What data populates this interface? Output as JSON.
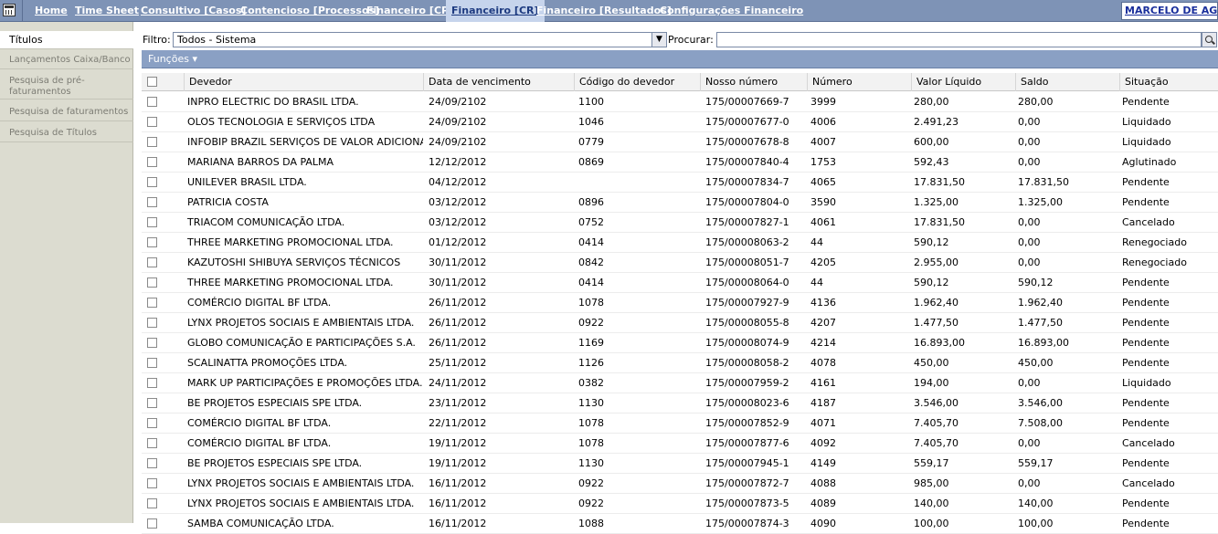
{
  "nav": {
    "links": [
      "Home",
      "Time Sheet",
      "Consultivo [Casos]",
      "Contencioso [Processos]",
      "Financeiro [CP]",
      "Financeiro [CR]",
      "Financeiro [Resultados]",
      "Configurações Financeiro"
    ],
    "active_index": 5,
    "user": "MARCELO DE AGUIAR"
  },
  "sidebar": {
    "items": [
      "Títulos",
      "Lançamentos Caixa/Banco",
      "Pesquisa de pré-faturamentos",
      "Pesquisa de faturamentos",
      "Pesquisa de Títulos"
    ],
    "active_index": 0
  },
  "filter": {
    "label": "Filtro:",
    "value": "Todos - Sistema",
    "search_label": "Procurar:",
    "search_value": ""
  },
  "functions_label": "Funções ▾",
  "table": {
    "columns": [
      "Devedor",
      "Data de vencimento",
      "Código do devedor",
      "Nosso número",
      "Número",
      "Valor Líquido",
      "Saldo",
      "Situação"
    ],
    "rows": [
      [
        "INPRO ELECTRIC DO BRASIL LTDA.",
        "24/09/2102",
        "1100",
        "175/00007669-7",
        "3999",
        "280,00",
        "280,00",
        "Pendente"
      ],
      [
        "OLOS TECNOLOGIA E SERVIÇOS LTDA",
        "24/09/2102",
        "1046",
        "175/00007677-0",
        "4006",
        "2.491,23",
        "0,00",
        "Liquidado"
      ],
      [
        "INFOBIP BRAZIL SERVIÇOS DE VALOR ADICIONADO",
        "24/09/2102",
        "0779",
        "175/00007678-8",
        "4007",
        "600,00",
        "0,00",
        "Liquidado"
      ],
      [
        "MARIANA BARROS DA PALMA",
        "12/12/2012",
        "0869",
        "175/00007840-4",
        "1753",
        "592,43",
        "0,00",
        "Aglutinado"
      ],
      [
        "UNILEVER BRASIL LTDA.",
        "04/12/2012",
        "",
        "175/00007834-7",
        "4065",
        "17.831,50",
        "17.831,50",
        "Pendente"
      ],
      [
        "PATRICIA COSTA",
        "03/12/2012",
        "0896",
        "175/00007804-0",
        "3590",
        "1.325,00",
        "1.325,00",
        "Pendente"
      ],
      [
        "TRIACOM COMUNICAÇÃO LTDA.",
        "03/12/2012",
        "0752",
        "175/00007827-1",
        "4061",
        "17.831,50",
        "0,00",
        "Cancelado"
      ],
      [
        "THREE MARKETING PROMOCIONAL LTDA.",
        "01/12/2012",
        "0414",
        "175/00008063-2",
        "44",
        "590,12",
        "0,00",
        "Renegociado"
      ],
      [
        "KAZUTOSHI SHIBUYA SERVIÇOS TÉCNICOS",
        "30/11/2012",
        "0842",
        "175/00008051-7",
        "4205",
        "2.955,00",
        "0,00",
        "Renegociado"
      ],
      [
        "THREE MARKETING PROMOCIONAL LTDA.",
        "30/11/2012",
        "0414",
        "175/00008064-0",
        "44",
        "590,12",
        "590,12",
        "Pendente"
      ],
      [
        "COMÉRCIO DIGITAL BF LTDA.",
        "26/11/2012",
        "1078",
        "175/00007927-9",
        "4136",
        "1.962,40",
        "1.962,40",
        "Pendente"
      ],
      [
        "LYNX PROJETOS SOCIAIS E AMBIENTAIS LTDA.",
        "26/11/2012",
        "0922",
        "175/00008055-8",
        "4207",
        "1.477,50",
        "1.477,50",
        "Pendente"
      ],
      [
        "GLOBO COMUNICAÇÃO E PARTICIPAÇÕES S.A.",
        "26/11/2012",
        "1169",
        "175/00008074-9",
        "4214",
        "16.893,00",
        "16.893,00",
        "Pendente"
      ],
      [
        "SCALINATTA PROMOÇÕES LTDA.",
        "25/11/2012",
        "1126",
        "175/00008058-2",
        "4078",
        "450,00",
        "450,00",
        "Pendente"
      ],
      [
        "MARK UP PARTICIPAÇÕES E PROMOÇÕES LTDA.",
        "24/11/2012",
        "0382",
        "175/00007959-2",
        "4161",
        "194,00",
        "0,00",
        "Liquidado"
      ],
      [
        "BE PROJETOS ESPECIAIS SPE LTDA.",
        "23/11/2012",
        "1130",
        "175/00008023-6",
        "4187",
        "3.546,00",
        "3.546,00",
        "Pendente"
      ],
      [
        "COMÉRCIO DIGITAL BF LTDA.",
        "22/11/2012",
        "1078",
        "175/00007852-9",
        "4071",
        "7.405,70",
        "7.508,00",
        "Pendente"
      ],
      [
        "COMÉRCIO DIGITAL BF LTDA.",
        "19/11/2012",
        "1078",
        "175/00007877-6",
        "4092",
        "7.405,70",
        "0,00",
        "Cancelado"
      ],
      [
        "BE PROJETOS ESPECIAIS SPE LTDA.",
        "19/11/2012",
        "1130",
        "175/00007945-1",
        "4149",
        "559,17",
        "559,17",
        "Pendente"
      ],
      [
        "LYNX PROJETOS SOCIAIS E AMBIENTAIS LTDA.",
        "16/11/2012",
        "0922",
        "175/00007872-7",
        "4088",
        "985,00",
        "0,00",
        "Cancelado"
      ],
      [
        "LYNX PROJETOS SOCIAIS E AMBIENTAIS LTDA.",
        "16/11/2012",
        "0922",
        "175/00007873-5",
        "4089",
        "140,00",
        "140,00",
        "Pendente"
      ],
      [
        "SAMBA COMUNICAÇÃO LTDA.",
        "16/11/2012",
        "1088",
        "175/00007874-3",
        "4090",
        "100,00",
        "100,00",
        "Pendente"
      ]
    ]
  }
}
